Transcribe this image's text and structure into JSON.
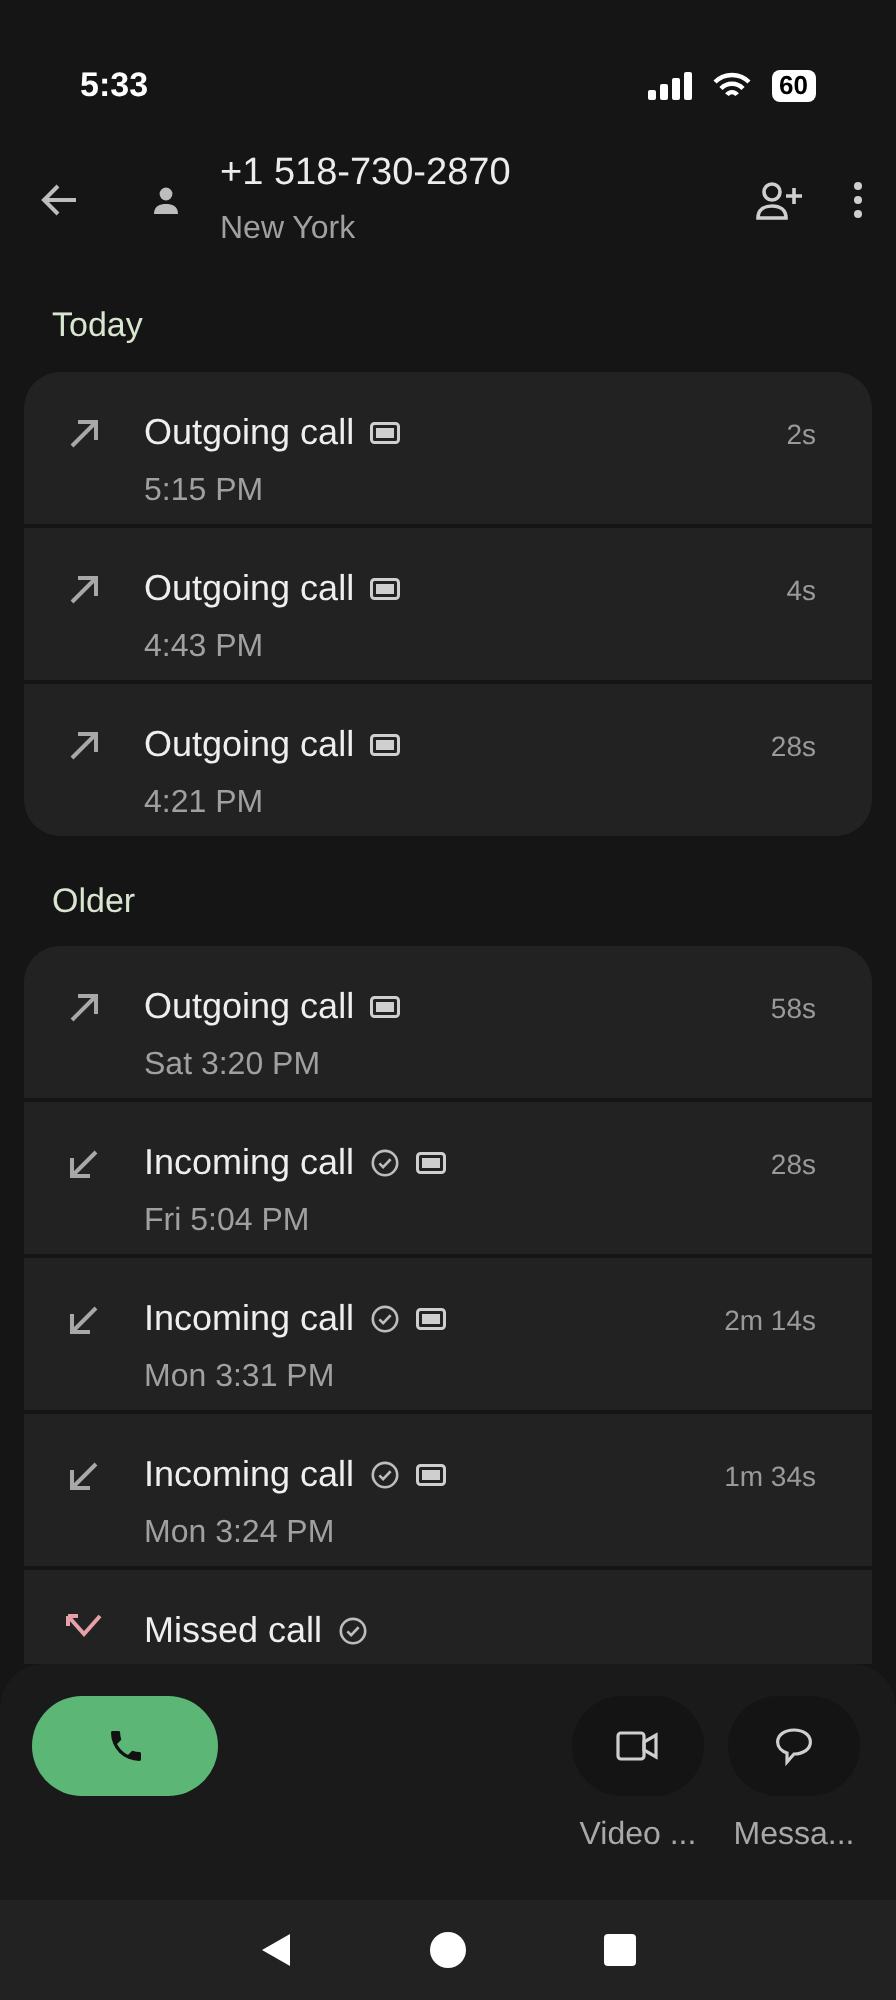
{
  "status_bar": {
    "time": "5:33",
    "battery": "60"
  },
  "header": {
    "number": "+1 518-730-2870",
    "location": "New York"
  },
  "sections": [
    {
      "title": "Today",
      "calls": [
        {
          "kind": "outgoing",
          "title": "Outgoing call",
          "verified": false,
          "hd": true,
          "time": "5:15 PM",
          "duration": "2s"
        },
        {
          "kind": "outgoing",
          "title": "Outgoing call",
          "verified": false,
          "hd": true,
          "time": "4:43 PM",
          "duration": "4s"
        },
        {
          "kind": "outgoing",
          "title": "Outgoing call",
          "verified": false,
          "hd": true,
          "time": "4:21 PM",
          "duration": "28s"
        }
      ]
    },
    {
      "title": "Older",
      "calls": [
        {
          "kind": "outgoing",
          "title": "Outgoing call",
          "verified": false,
          "hd": true,
          "time": "Sat 3:20 PM",
          "duration": "58s"
        },
        {
          "kind": "incoming",
          "title": "Incoming call",
          "verified": true,
          "hd": true,
          "time": "Fri 5:04 PM",
          "duration": "28s"
        },
        {
          "kind": "incoming",
          "title": "Incoming call",
          "verified": true,
          "hd": true,
          "time": "Mon 3:31 PM",
          "duration": "2m 14s"
        },
        {
          "kind": "incoming",
          "title": "Incoming call",
          "verified": true,
          "hd": true,
          "time": "Mon 3:24 PM",
          "duration": "1m 34s"
        },
        {
          "kind": "missed",
          "title": "Missed call",
          "verified": true,
          "hd": false
        }
      ]
    }
  ],
  "actions": [
    {
      "kind": "video",
      "label": "Video ..."
    },
    {
      "kind": "message",
      "label": "Messa..."
    }
  ]
}
